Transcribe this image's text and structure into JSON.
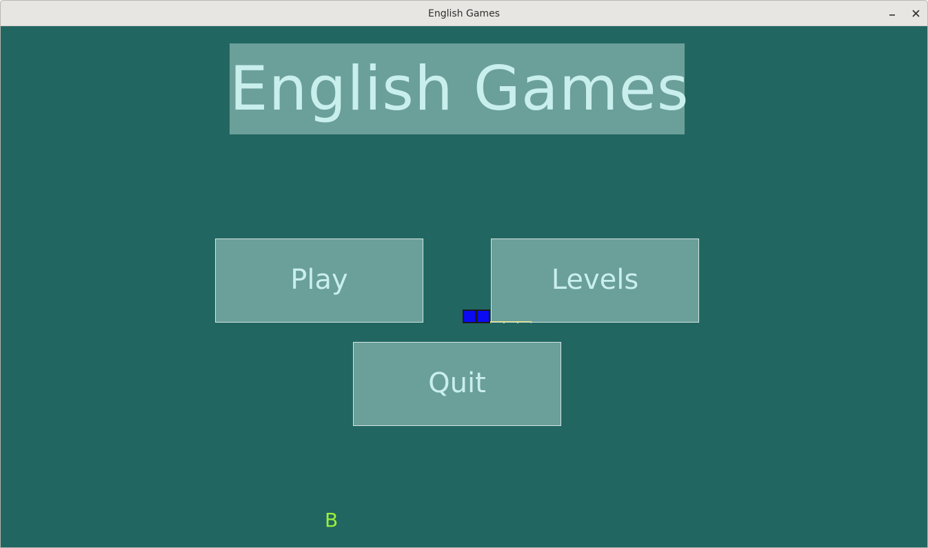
{
  "window": {
    "title": "English Games"
  },
  "game": {
    "title": "English Games",
    "buttons": {
      "play": "Play",
      "levels": "Levels",
      "quit": "Quit"
    },
    "floating_letter": "B"
  },
  "colors": {
    "background": "#226661",
    "panel": "#6b9f9a",
    "text": "#c9efec",
    "letter": "#9cf03a",
    "block": "#0a0af5"
  },
  "icons": {
    "minimize": "minimize-icon",
    "close": "close-icon"
  }
}
